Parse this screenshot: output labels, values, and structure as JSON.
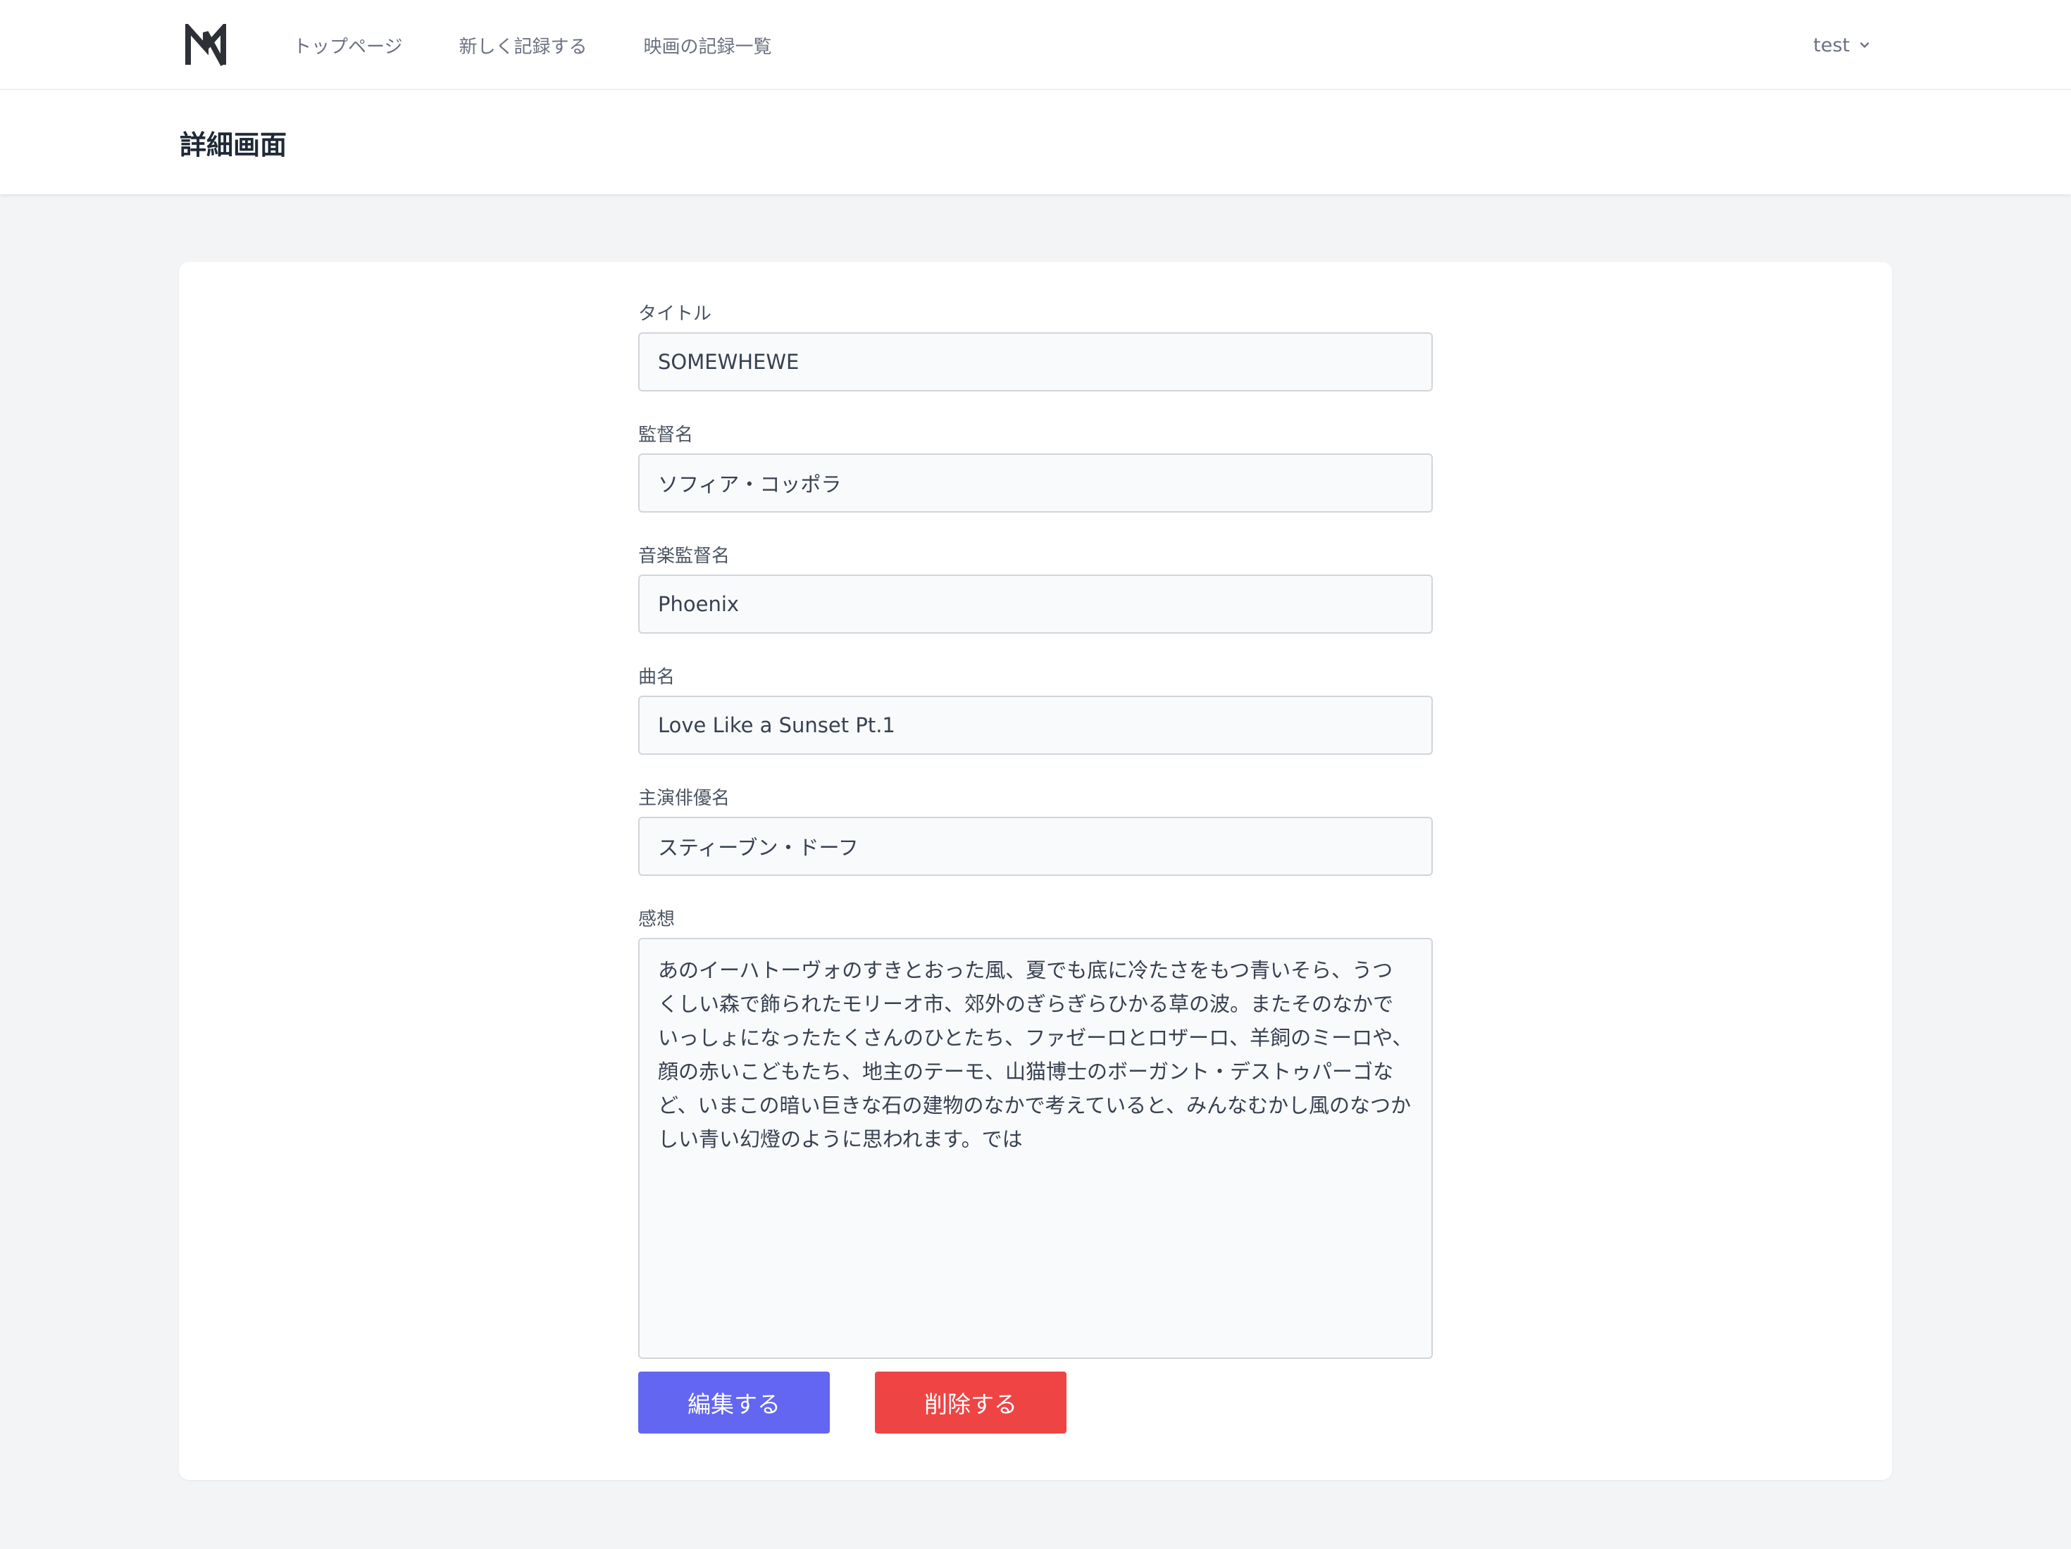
{
  "nav": {
    "logo": "M",
    "links": [
      {
        "label": "トップページ"
      },
      {
        "label": "新しく記録する"
      },
      {
        "label": "映画の記録一覧"
      }
    ],
    "user": {
      "name": "test",
      "icon": "chevron-down-icon"
    }
  },
  "header": {
    "title": "詳細画面"
  },
  "form": {
    "title": {
      "label": "タイトル",
      "value": "SOMEWHEWE"
    },
    "director": {
      "label": "監督名",
      "value": "ソフィア・コッポラ"
    },
    "music_director": {
      "label": "音楽監督名",
      "value": "Phoenix"
    },
    "song": {
      "label": "曲名",
      "value": "Love Like a Sunset Pt.1"
    },
    "lead_actor": {
      "label": "主演俳優名",
      "value": "スティーブン・ドーフ"
    },
    "impression": {
      "label": "感想",
      "value": "あのイーハトーヴォのすきとおった風、夏でも底に冷たさをもつ青いそら、うつくしい森で飾られたモリーオ市、郊外のぎらぎらひかる草の波。またそのなかでいっしょになったたくさんのひとたち、ファゼーロとロザーロ、羊飼のミーロや、顔の赤いこどもたち、地主のテーモ、山猫博士のボーガント・デストゥパーゴなど、いまこの暗い巨きな石の建物のなかで考えていると、みんなむかし風のなつかしい青い幻燈のように思われます。では"
    }
  },
  "actions": {
    "edit_label": "編集する",
    "delete_label": "削除する"
  },
  "colors": {
    "edit_button": "#6366f1",
    "delete_button": "#ef4444",
    "page_background": "#f3f4f6"
  }
}
